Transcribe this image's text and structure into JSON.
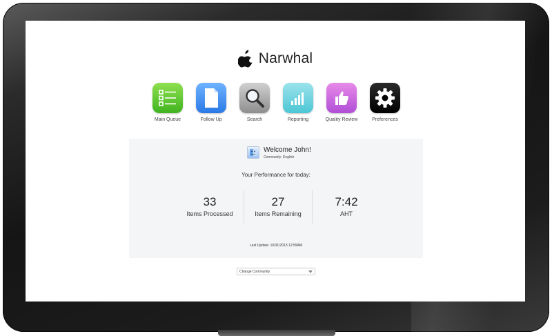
{
  "brand": {
    "title": "Narwhal",
    "logo_icon": "apple-logo-icon"
  },
  "apps": [
    {
      "label": "Main Queue",
      "icon": "list-icon",
      "color": "#5cc631"
    },
    {
      "label": "Follow Up",
      "icon": "document-icon",
      "color": "#3b8bf0"
    },
    {
      "label": "Search",
      "icon": "magnifier-icon",
      "color": "#a3a3a3"
    },
    {
      "label": "Reporting",
      "icon": "bar-chart-icon",
      "color": "#6fd1dd"
    },
    {
      "label": "Quality Review",
      "icon": "thumbs-up-icon",
      "color": "#c860dd"
    },
    {
      "label": "Preferences",
      "icon": "gear-icon",
      "color": "#111111"
    }
  ],
  "welcome": {
    "title": "Welcome John!",
    "community": "Community: English"
  },
  "performance": {
    "heading": "Your Performance for today:",
    "stats": [
      {
        "value": "33",
        "label": "Items Processed"
      },
      {
        "value": "27",
        "label": "Items Remaining"
      },
      {
        "value": "7:42",
        "label": "AHT"
      }
    ],
    "last_update": "Last Update: 10/31/2013 12:59AM"
  },
  "community_select": {
    "selected": "Change Community"
  }
}
